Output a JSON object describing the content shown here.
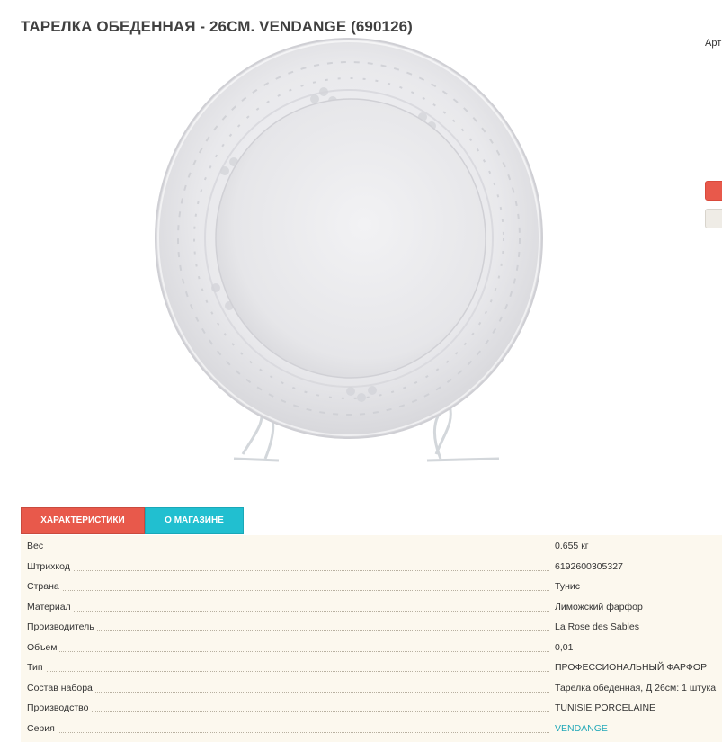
{
  "product": {
    "title": "ТАРЕЛКА ОБЕДЕННАЯ - 26СМ. VENDANGE (690126)",
    "art_label": "Арт",
    "color_options": [
      "#e8594b",
      "#efece6"
    ]
  },
  "tabs": [
    {
      "label": "ХАРАКТЕРИСТИКИ",
      "active": true
    },
    {
      "label": "О МАГАЗИНЕ",
      "active": false
    }
  ],
  "specs": [
    {
      "label": "Вес",
      "value": "0.655 кг"
    },
    {
      "label": "Штрихкод",
      "value": "6192600305327"
    },
    {
      "label": "Страна",
      "value": "Тунис"
    },
    {
      "label": "Материал",
      "value": "Лиможский фарфор"
    },
    {
      "label": "Производитель",
      "value": "La Rose des Sables"
    },
    {
      "label": "Объем",
      "value": "0,01"
    },
    {
      "label": "Тип",
      "value": "ПРОФЕССИОНАЛЬНЫЙ ФАРФОР"
    },
    {
      "label": "Состав набора",
      "value": "Тарелка обеденная, Д 26см: 1 штука"
    },
    {
      "label": "Производство",
      "value": "TUNISIE PORCELAINE"
    },
    {
      "label": "Серия",
      "value": "VENDANGE",
      "link": true
    }
  ]
}
